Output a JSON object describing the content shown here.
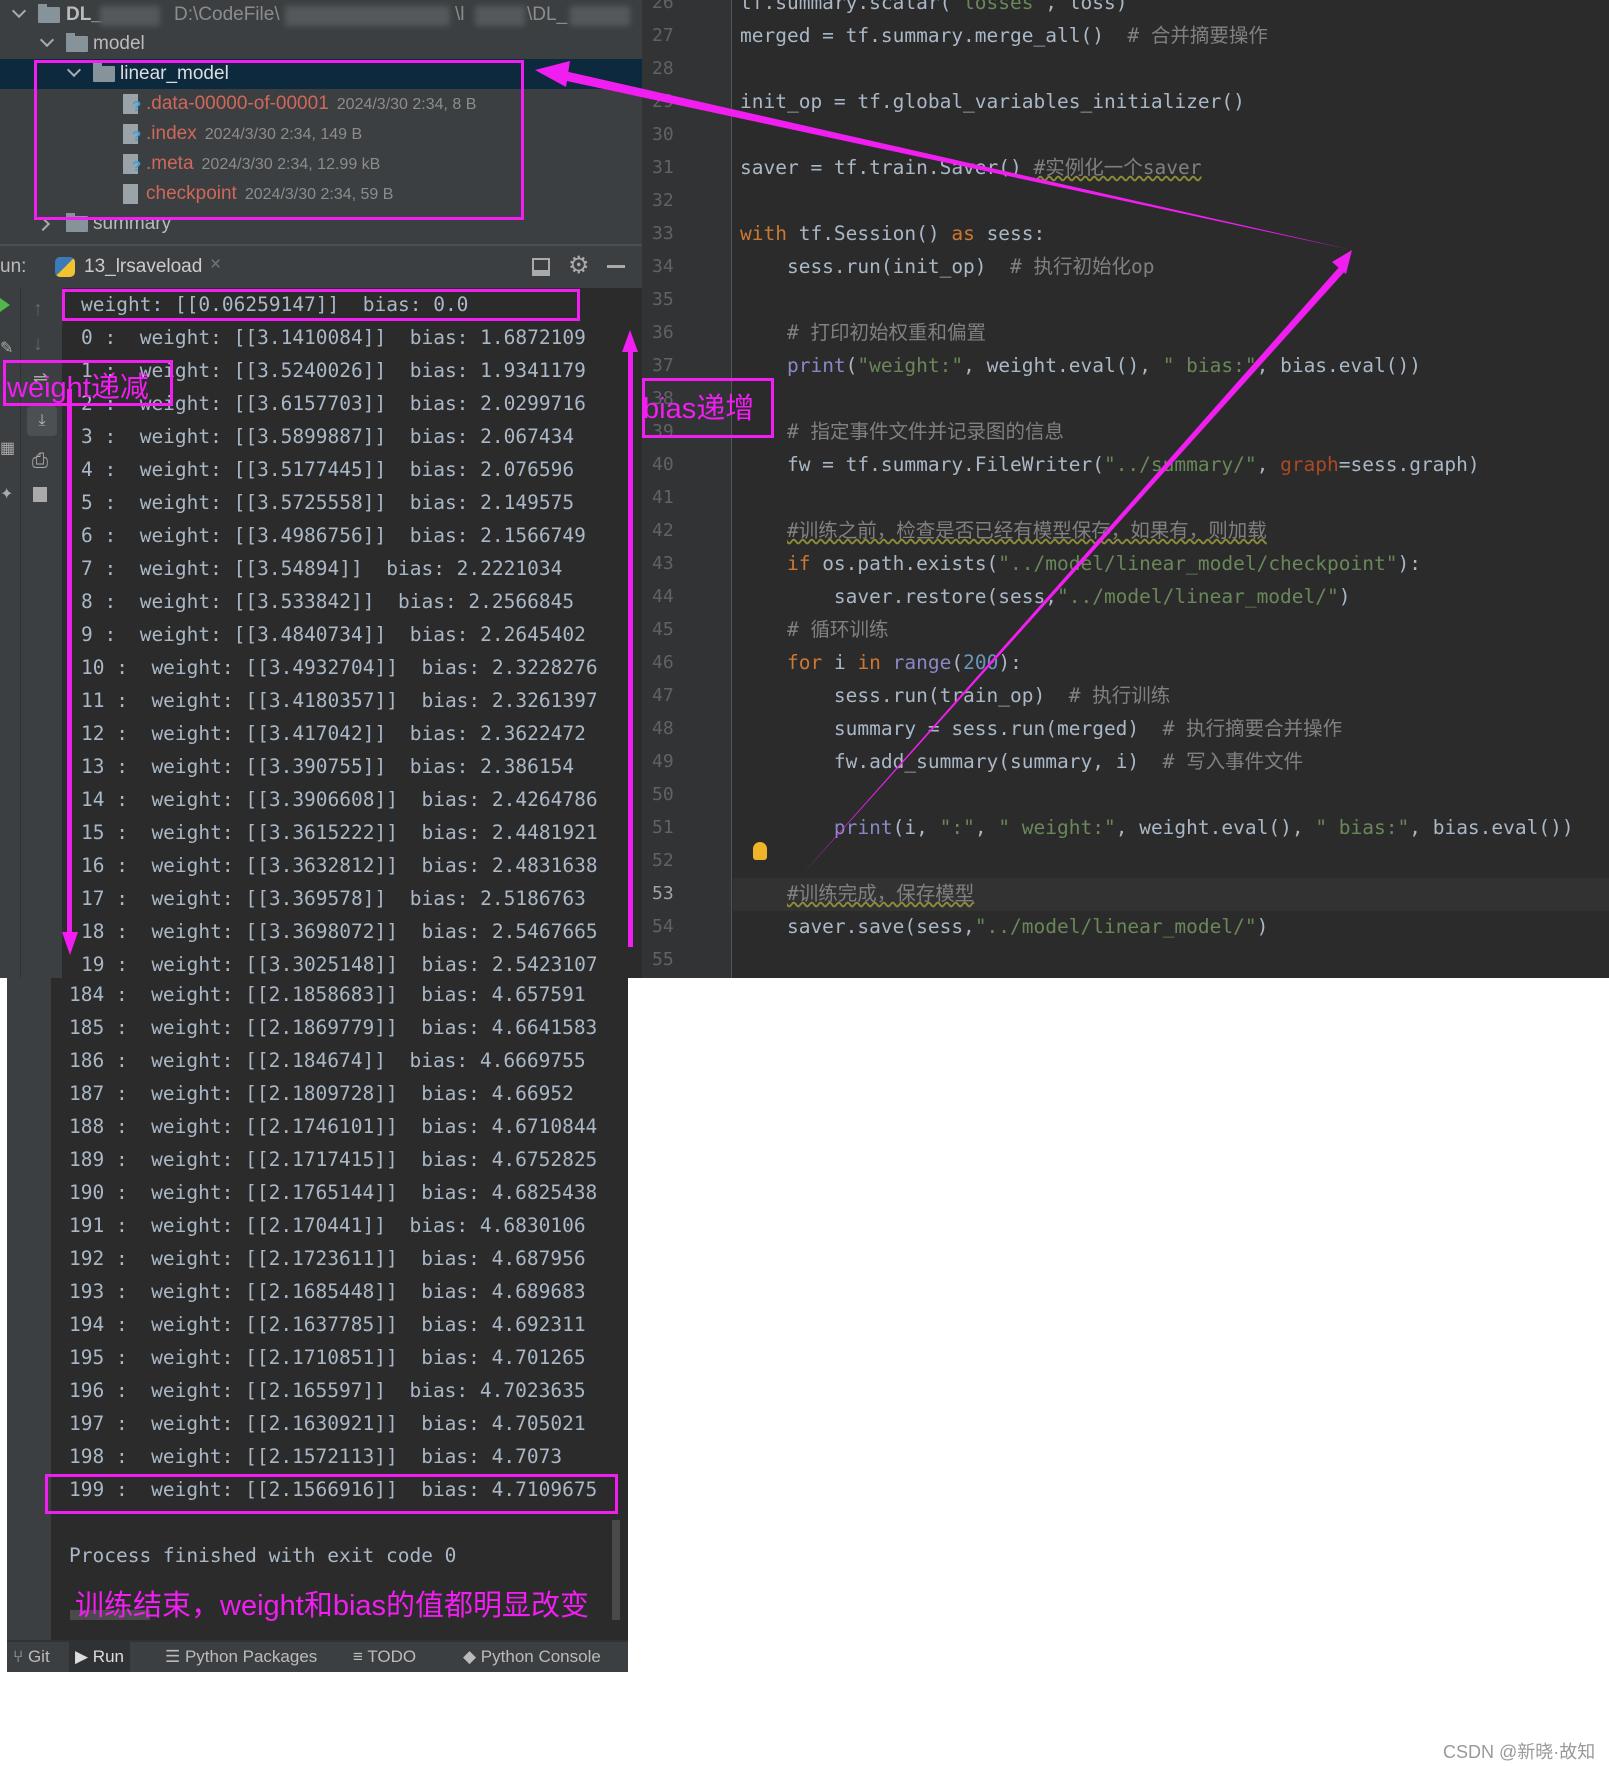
{
  "project_tree": {
    "root": {
      "name": "DL_",
      "path": "D:\\CodeFile\\",
      "path_tail_1": "\\l",
      "path_tail_2": "\\DL_"
    },
    "model_folder": "model",
    "linear_model_folder": "linear_model",
    "files": [
      {
        "name": ".data-00000-of-00001",
        "meta": "2024/3/30 2:34, 8 B",
        "icon": "unknown-file-icon"
      },
      {
        "name": ".index",
        "meta": "2024/3/30 2:34, 149 B",
        "icon": "unknown-file-icon"
      },
      {
        "name": ".meta",
        "meta": "2024/3/30 2:34, 12.99 kB",
        "icon": "unknown-file-icon"
      },
      {
        "name": "checkpoint",
        "meta": "2024/3/30 2:34, 59 B",
        "icon": "text-file-icon"
      }
    ],
    "summary_folder": "summary"
  },
  "run_panel": {
    "label": "un:",
    "tab_title": "13_lrsaveload",
    "initial_output": "weight: [[0.06259147]]  bias: 0.0",
    "output_head": [
      "0 :  weight: [[3.1410084]]  bias: 1.6872109",
      "1 :  weight: [[3.5240026]]  bias: 1.9341179",
      "2 :  weight: [[3.6157703]]  bias: 2.0299716",
      "3 :  weight: [[3.5899887]]  bias: 2.067434",
      "4 :  weight: [[3.5177445]]  bias: 2.076596",
      "5 :  weight: [[3.5725558]]  bias: 2.149575",
      "6 :  weight: [[3.4986756]]  bias: 2.1566749",
      "7 :  weight: [[3.54894]]  bias: 2.2221034",
      "8 :  weight: [[3.533842]]  bias: 2.2566845",
      "9 :  weight: [[3.4840734]]  bias: 2.2645402",
      "10 :  weight: [[3.4932704]]  bias: 2.3228276",
      "11 :  weight: [[3.4180357]]  bias: 2.3261397",
      "12 :  weight: [[3.417042]]  bias: 2.3622472",
      "13 :  weight: [[3.390755]]  bias: 2.386154",
      "14 :  weight: [[3.3906608]]  bias: 2.4264786",
      "15 :  weight: [[3.3615222]]  bias: 2.4481921",
      "16 :  weight: [[3.3632812]]  bias: 2.4831638",
      "17 :  weight: [[3.369578]]  bias: 2.5186763",
      "18 :  weight: [[3.3698072]]  bias: 2.5467665",
      "19 :  weight: [[3.3025148]]  bias: 2.5423107"
    ],
    "output_tail": [
      "184 :  weight: [[2.1858683]]  bias: 4.657591",
      "185 :  weight: [[2.1869779]]  bias: 4.6641583",
      "186 :  weight: [[2.184674]]  bias: 4.6669755",
      "187 :  weight: [[2.1809728]]  bias: 4.66952",
      "188 :  weight: [[2.1746101]]  bias: 4.6710844",
      "189 :  weight: [[2.1717415]]  bias: 4.6752825",
      "190 :  weight: [[2.1765144]]  bias: 4.6825438",
      "191 :  weight: [[2.170441]]  bias: 4.6830106",
      "192 :  weight: [[2.1723611]]  bias: 4.687956",
      "193 :  weight: [[2.1685448]]  bias: 4.689683",
      "194 :  weight: [[2.1637785]]  bias: 4.692311",
      "195 :  weight: [[2.1710851]]  bias: 4.701265",
      "196 :  weight: [[2.165597]]  bias: 4.7023635",
      "197 :  weight: [[2.1630921]]  bias: 4.705021",
      "198 :  weight: [[2.1572113]]  bias: 4.7073",
      "199 :  weight: [[2.1566916]]  bias: 4.7109675"
    ],
    "exit_message": "Process finished with exit code 0"
  },
  "bottom_tabs": [
    {
      "label": "Git",
      "icon": "git-icon"
    },
    {
      "label": "Run",
      "icon": "play-icon",
      "active": true
    },
    {
      "label": "Python Packages",
      "icon": "layers-icon"
    },
    {
      "label": "TODO",
      "icon": "list-icon"
    },
    {
      "label": "Python Console",
      "icon": "python-icon"
    }
  ],
  "editor": {
    "first_line_number": 26,
    "current_line": 53,
    "lines": [
      [
        [
          "tf.summary.scalar(",
          ""
        ],
        [
          "\"losses\"",
          "str"
        ],
        [
          ", loss)",
          ""
        ]
      ],
      [
        [
          "merged = tf.summary.merge_all()  ",
          ""
        ],
        [
          "# 合并摘要操作",
          "cm"
        ]
      ],
      [],
      [
        [
          "init_op = tf.global_variables_initializer()",
          ""
        ]
      ],
      [],
      [
        [
          "saver = tf.train.Saver() ",
          ""
        ],
        [
          "#实例化一个saver",
          "cm wavy"
        ]
      ],
      [],
      [
        [
          "with",
          "kw"
        ],
        [
          " tf.Session() ",
          ""
        ],
        [
          "as",
          "kw"
        ],
        [
          " sess:",
          ""
        ]
      ],
      [
        [
          "    sess.run(init_op)  ",
          ""
        ],
        [
          "# 执行初始化op",
          "cm"
        ]
      ],
      [],
      [
        [
          "    ",
          ""
        ],
        [
          "# 打印初始权重和偏置",
          "cm"
        ]
      ],
      [
        [
          "    ",
          ""
        ],
        [
          "print",
          "bi"
        ],
        [
          "(",
          ""
        ],
        [
          "\"weight:\"",
          "str"
        ],
        [
          ", weight.eval(), ",
          ""
        ],
        [
          "\" bias:\"",
          "str"
        ],
        [
          ", bias.eval())",
          ""
        ]
      ],
      [],
      [
        [
          "    ",
          ""
        ],
        [
          "# 指定事件文件并记录图的信息",
          "cm"
        ]
      ],
      [
        [
          "    fw = tf.summary.FileWriter(",
          ""
        ],
        [
          "\"../summary/\"",
          "str"
        ],
        [
          ", ",
          ""
        ],
        [
          "graph",
          "pm"
        ],
        [
          "=sess.graph)",
          ""
        ]
      ],
      [],
      [
        [
          "    ",
          ""
        ],
        [
          "#训练之前，检查是否已经有模型保存，如果有，则加载",
          "cm wavy"
        ]
      ],
      [
        [
          "    ",
          ""
        ],
        [
          "if",
          "kw"
        ],
        [
          " os.path.exists(",
          ""
        ],
        [
          "\"../model/linear_model/checkpoint\"",
          "str"
        ],
        [
          "):",
          ""
        ]
      ],
      [
        [
          "        saver.restore(sess,",
          ""
        ],
        [
          "\"../model/linear_model/\"",
          "str"
        ],
        [
          ")",
          ""
        ]
      ],
      [
        [
          "    ",
          ""
        ],
        [
          "# 循环训练",
          "cm"
        ]
      ],
      [
        [
          "    ",
          ""
        ],
        [
          "for",
          "kw"
        ],
        [
          " i ",
          ""
        ],
        [
          "in",
          "kw"
        ],
        [
          " ",
          ""
        ],
        [
          "range",
          "bi"
        ],
        [
          "(",
          ""
        ],
        [
          "200",
          "num"
        ],
        [
          "):",
          ""
        ]
      ],
      [
        [
          "        sess.run(train_op)  ",
          ""
        ],
        [
          "# 执行训练",
          "cm"
        ]
      ],
      [
        [
          "        summary = sess.run(merged)  ",
          ""
        ],
        [
          "# 执行摘要合并操作",
          "cm"
        ]
      ],
      [
        [
          "        fw.add_summary(summary, i)  ",
          ""
        ],
        [
          "# 写入事件文件",
          "cm"
        ]
      ],
      [],
      [
        [
          "        ",
          ""
        ],
        [
          "print",
          "bi"
        ],
        [
          "(i, ",
          ""
        ],
        [
          "\":\"",
          "str"
        ],
        [
          ", ",
          ""
        ],
        [
          "\" weight:\"",
          "str"
        ],
        [
          ", weight.eval(), ",
          ""
        ],
        [
          "\" bias:\"",
          "str"
        ],
        [
          ", bias.eval())",
          ""
        ]
      ],
      [],
      [
        [
          "    ",
          ""
        ],
        [
          "#训练完成，保存模型",
          "cm wavy"
        ]
      ],
      [
        [
          "    saver.save(sess,",
          ""
        ],
        [
          "\"../model/linear_model/\"",
          "str"
        ],
        [
          ")",
          ""
        ]
      ],
      []
    ]
  },
  "annotations": {
    "weight_label": "weight递减",
    "bias_label": "bias递增",
    "conclusion": "训练结束，weight和bias的值都明显改变",
    "color": "#f01ef0"
  },
  "watermark": "CSDN @新晓·故知",
  "colors": {
    "editor_bg": "#2b2b2b",
    "panel_bg": "#3c3f41",
    "selection": "#0d293e",
    "keyword": "#cc7832",
    "string": "#6a8759",
    "comment": "#808080",
    "ignored_file": "#d1675a"
  }
}
